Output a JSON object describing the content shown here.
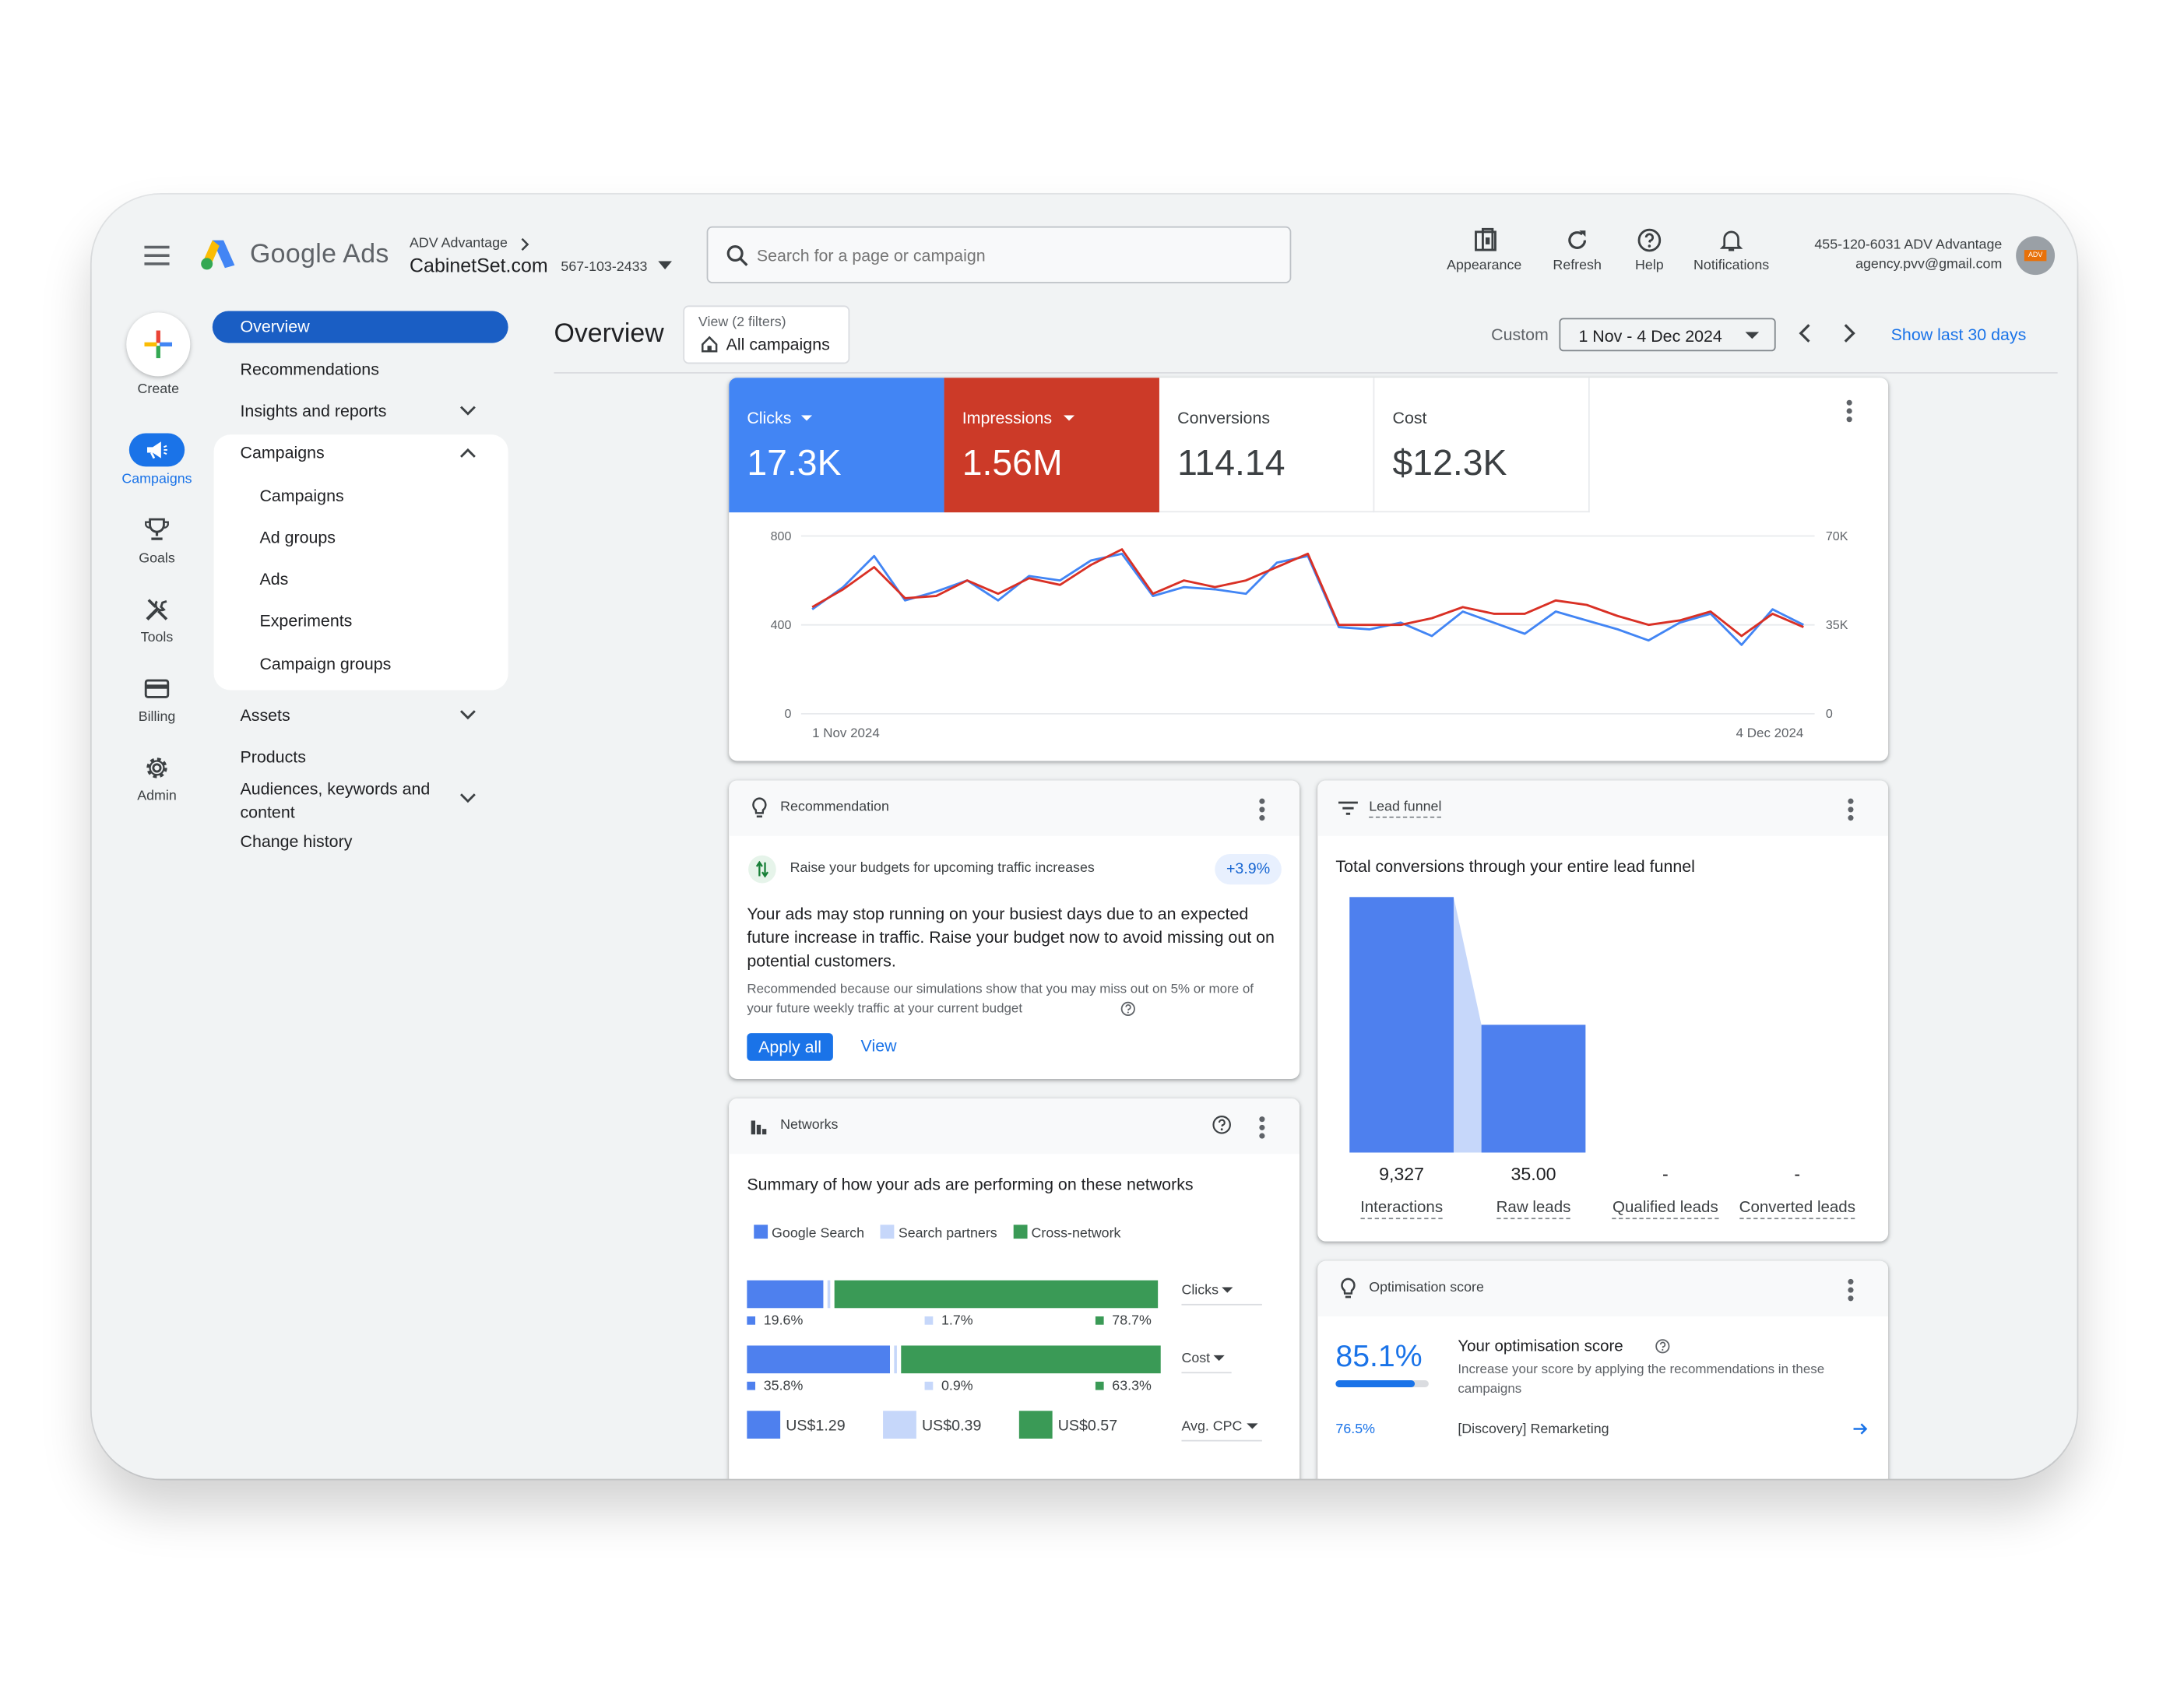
{
  "header": {
    "product_name": "Google Ads",
    "account_parent": "ADV Advantage",
    "account_name": "CabinetSet.com",
    "account_id": "567-103-2433",
    "search_placeholder": "Search for a page or campaign",
    "tools": [
      {
        "label": "Appearance",
        "icon": "appearance-icon"
      },
      {
        "label": "Refresh",
        "icon": "refresh-icon"
      },
      {
        "label": "Help",
        "icon": "help-icon"
      },
      {
        "label": "Notifications",
        "icon": "bell-icon"
      }
    ],
    "user_line1": "455-120-6031 ADV Advantage",
    "user_line2": "agency.pvv@gmail.com",
    "avatar_text": "ADV"
  },
  "rail": [
    {
      "label": "Create",
      "icon": "plus-icon"
    },
    {
      "label": "Campaigns",
      "icon": "megaphone-icon",
      "active": true
    },
    {
      "label": "Goals",
      "icon": "trophy-icon"
    },
    {
      "label": "Tools",
      "icon": "tools-icon"
    },
    {
      "label": "Billing",
      "icon": "credit-card-icon"
    },
    {
      "label": "Admin",
      "icon": "gear-icon"
    }
  ],
  "nav": {
    "overview": "Overview",
    "recommendations": "Recommendations",
    "insights": "Insights and reports",
    "campaigns_group": "Campaigns",
    "campaigns_sub": [
      "Campaigns",
      "Ad groups",
      "Ads",
      "Experiments",
      "Campaign groups"
    ],
    "assets": "Assets",
    "products": "Products",
    "audiences": "Audiences, keywords and content",
    "change_history": "Change history"
  },
  "page": {
    "title": "Overview",
    "view_filter_label": "View (2 filters)",
    "view_filter_value": "All campaigns",
    "date_mode": "Custom",
    "date_range": "1 Nov - 4 Dec 2024",
    "show_last": "Show last 30 days"
  },
  "metrics": [
    {
      "label": "Clicks",
      "value": "17.3K",
      "color": "#4285f4"
    },
    {
      "label": "Impressions",
      "value": "1.56M",
      "color": "#d93025"
    },
    {
      "label": "Conversions",
      "value": "114.14"
    },
    {
      "label": "Cost",
      "value": "$12.3K"
    }
  ],
  "chart_data": {
    "type": "line",
    "x_start_label": "1 Nov 2024",
    "x_end_label": "4 Dec 2024",
    "y_left_ticks": [
      "800",
      "400",
      "0"
    ],
    "y_right_ticks": [
      "70K",
      "35K",
      "0"
    ],
    "ylim_left": [
      0,
      800
    ],
    "ylim_right": [
      0,
      70000
    ],
    "series": [
      {
        "name": "Clicks",
        "color": "#4285f4",
        "axis": "left",
        "values": [
          470,
          570,
          710,
          510,
          550,
          600,
          510,
          620,
          600,
          690,
          720,
          530,
          570,
          560,
          540,
          680,
          710,
          390,
          380,
          410,
          350,
          460,
          410,
          360,
          460,
          420,
          380,
          330,
          410,
          450,
          310,
          470,
          400
        ]
      },
      {
        "name": "Impressions",
        "color": "#d93025",
        "axis": "left",
        "values": [
          480,
          560,
          660,
          520,
          530,
          600,
          540,
          610,
          580,
          670,
          740,
          540,
          600,
          570,
          600,
          660,
          720,
          400,
          400,
          400,
          430,
          480,
          450,
          450,
          510,
          490,
          440,
          400,
          420,
          460,
          350,
          450,
          390
        ]
      }
    ]
  },
  "recommendation": {
    "header": "Recommendation",
    "item_title": "Raise your budgets for upcoming traffic increases",
    "uplift": "+3.9%",
    "body": "Your ads may stop running on your busiest days due to an expected future increase in traffic. Raise your budget now to avoid missing out on potential customers.",
    "reason": "Recommended because our simulations show that you may miss out on 5% or more of your future weekly traffic at your current budget",
    "apply_all": "Apply all",
    "view": "View"
  },
  "networks": {
    "header": "Networks",
    "subtitle": "Summary of how your ads are performing on these networks",
    "legend": [
      {
        "label": "Google Search",
        "color": "#4e80ee"
      },
      {
        "label": "Search partners",
        "color": "#c6d7fa"
      },
      {
        "label": "Cross-network",
        "color": "#3a9a56"
      }
    ],
    "rows": [
      {
        "metric": "Clicks",
        "values": [
          "19.6%",
          "1.7%",
          "78.7%"
        ],
        "fractions": [
          0.196,
          0.017,
          0.787
        ]
      },
      {
        "metric": "Cost",
        "values": [
          "35.8%",
          "0.9%",
          "63.3%"
        ],
        "fractions": [
          0.358,
          0.009,
          0.633
        ]
      }
    ],
    "avg_cpc": {
      "metric": "Avg. CPC",
      "values": [
        "US$1.29",
        "US$0.39",
        "US$0.57"
      ]
    }
  },
  "lead_funnel": {
    "header": "Lead funnel",
    "subtitle": "Total conversions through your entire lead funnel",
    "stages": [
      {
        "label": "Interactions",
        "value": "9,327"
      },
      {
        "label": "Raw leads",
        "value": "35.00"
      },
      {
        "label": "Qualified leads",
        "value": "-"
      },
      {
        "label": "Converted leads",
        "value": "-"
      }
    ]
  },
  "optimisation": {
    "header": "Optimisation score",
    "score": "85.1%",
    "score_fraction": 0.851,
    "title": "Your optimisation score",
    "description": "Increase your score by applying the recommendations in these campaigns",
    "campaign_score": "76.5%",
    "campaign_name": "[Discovery] Remarketing"
  }
}
